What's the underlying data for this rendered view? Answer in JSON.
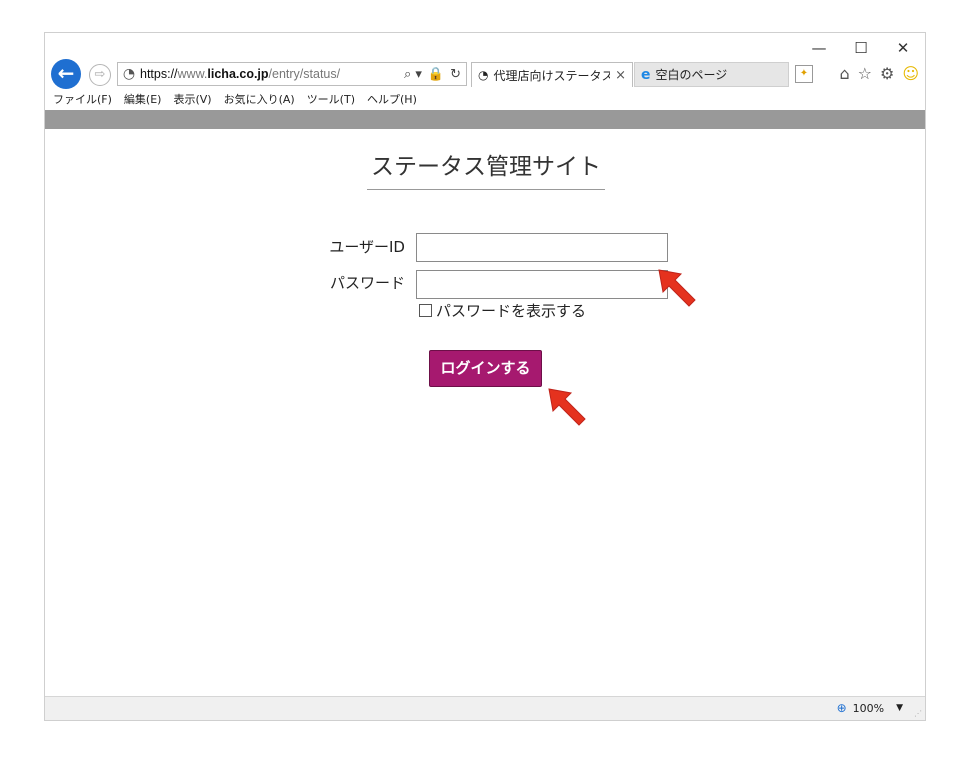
{
  "window": {
    "minimize": "—",
    "maximize": "☐",
    "close": "✕"
  },
  "nav": {
    "back": "←",
    "forward": "⇨",
    "address": {
      "proto": "https://",
      "www": "www.",
      "domain": "licha.co.jp",
      "path": "/entry/status/"
    },
    "address_tools": [
      "⌕ ▾",
      "🔒",
      "↻"
    ]
  },
  "tabs": [
    {
      "label": "代理店向けステータス...",
      "close": "×",
      "icon": "site-icon"
    },
    {
      "label": "空白のページ",
      "icon": "ie-icon"
    }
  ],
  "toolbar_icons": [
    "home-icon",
    "favorites-star-icon",
    "settings-gear-icon",
    "smiley-feedback-icon"
  ],
  "menubar": [
    "ファイル(F)",
    "編集(E)",
    "表示(V)",
    "お気に入り(A)",
    "ツール(T)",
    "ヘルプ(H)"
  ],
  "page": {
    "title": "ステータス管理サイト",
    "user_id_label": "ユーザーID",
    "password_label": "パスワード",
    "user_id_value": "",
    "password_value": "",
    "show_password_label": "パスワードを表示する",
    "login_button": "ログインする"
  },
  "statusbar": {
    "zoom": "100%"
  },
  "colors": {
    "login_button": "#a6196f",
    "header_band": "#999999",
    "annotation_arrow": "#e5321e",
    "back_button": "#1f6fd1"
  }
}
